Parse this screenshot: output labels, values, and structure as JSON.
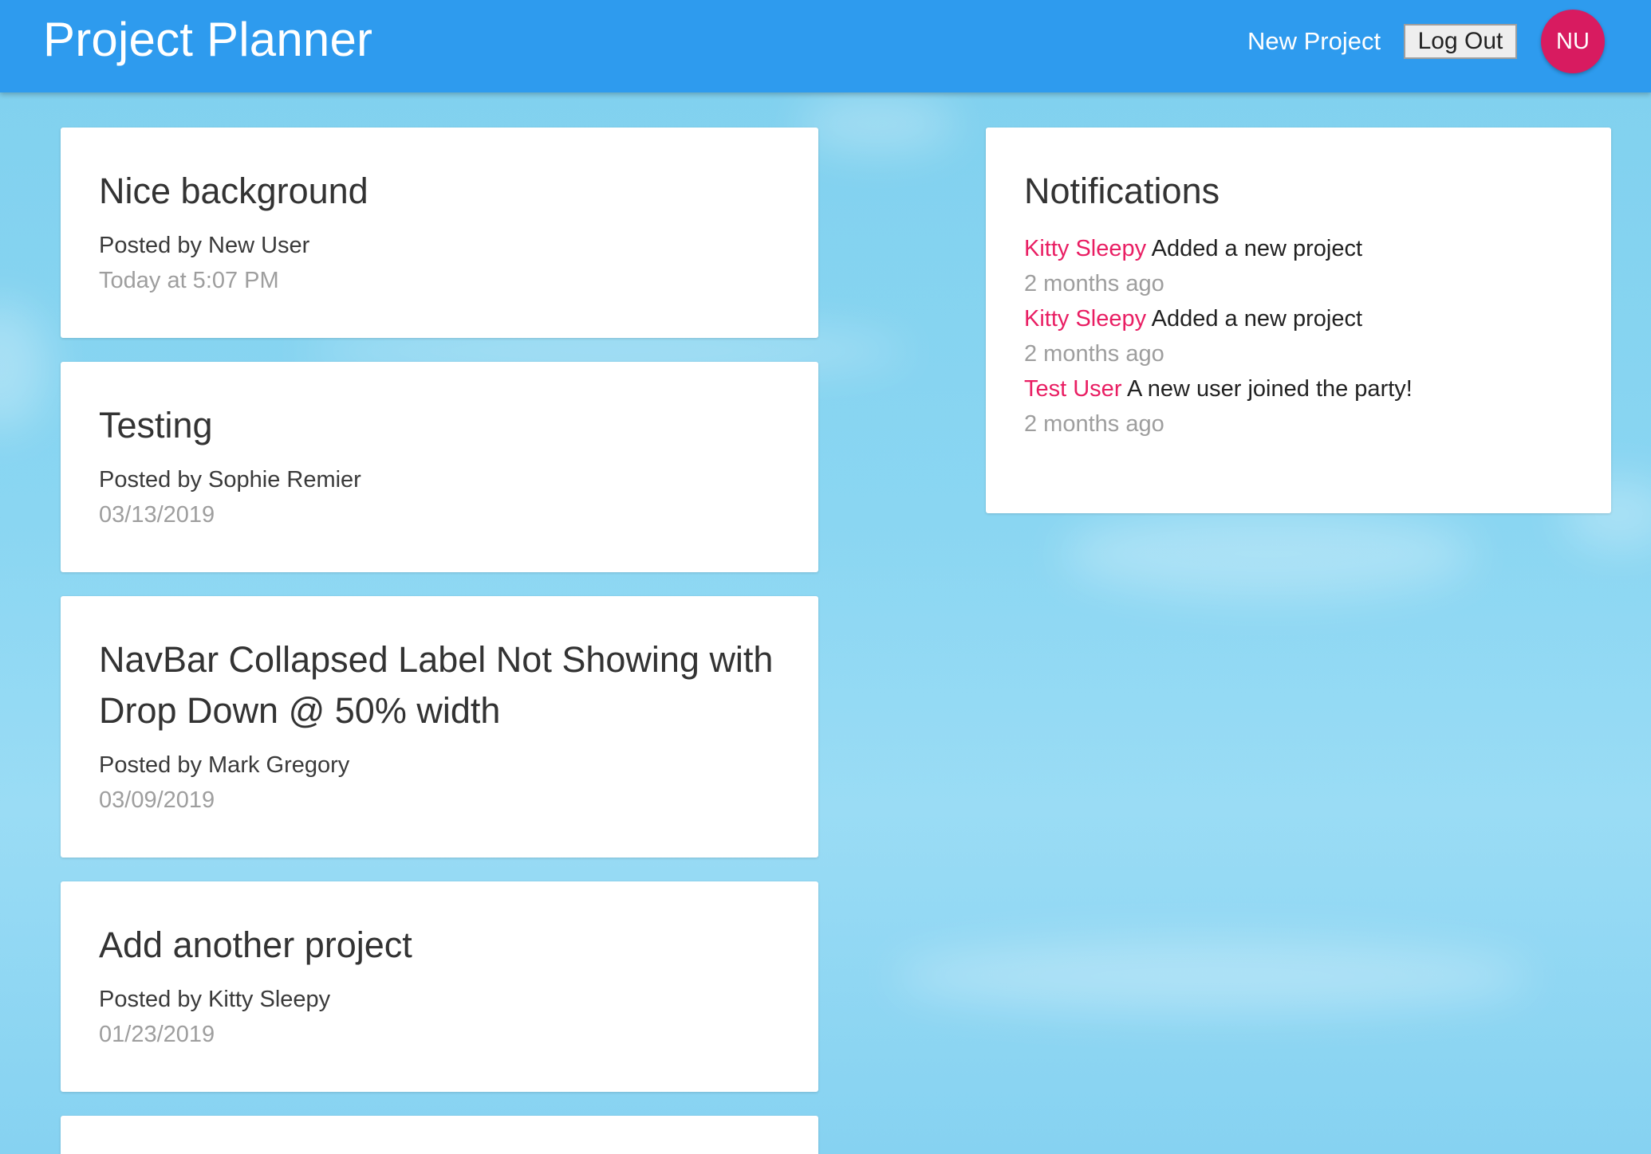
{
  "app": {
    "brand": "Project Planner"
  },
  "navbar": {
    "new_project_label": "New Project",
    "logout_label": "Log Out",
    "avatar_initials": "NU",
    "background_color": "#2e9bee",
    "avatar_color": "#d81b60"
  },
  "projects": [
    {
      "title": "Nice background",
      "author": "Posted by New User",
      "date": "Today at 5:07 PM"
    },
    {
      "title": "Testing",
      "author": "Posted by Sophie Remier",
      "date": "03/13/2019"
    },
    {
      "title": "NavBar Collapsed Label Not Showing with Drop Down @ 50% width",
      "author": "Posted by Mark Gregory",
      "date": "03/09/2019"
    },
    {
      "title": "Add another project",
      "author": "Posted by Kitty Sleepy",
      "date": "01/23/2019"
    }
  ],
  "notifications": {
    "heading": "Notifications",
    "items": [
      {
        "user": "Kitty Sleepy",
        "message": "Added a new project",
        "time": "2 months ago"
      },
      {
        "user": "Kitty Sleepy",
        "message": "Added a new project",
        "time": "2 months ago"
      },
      {
        "user": "Test User",
        "message": "A new user joined the party!",
        "time": "2 months ago"
      }
    ],
    "user_color": "#e91e63"
  }
}
